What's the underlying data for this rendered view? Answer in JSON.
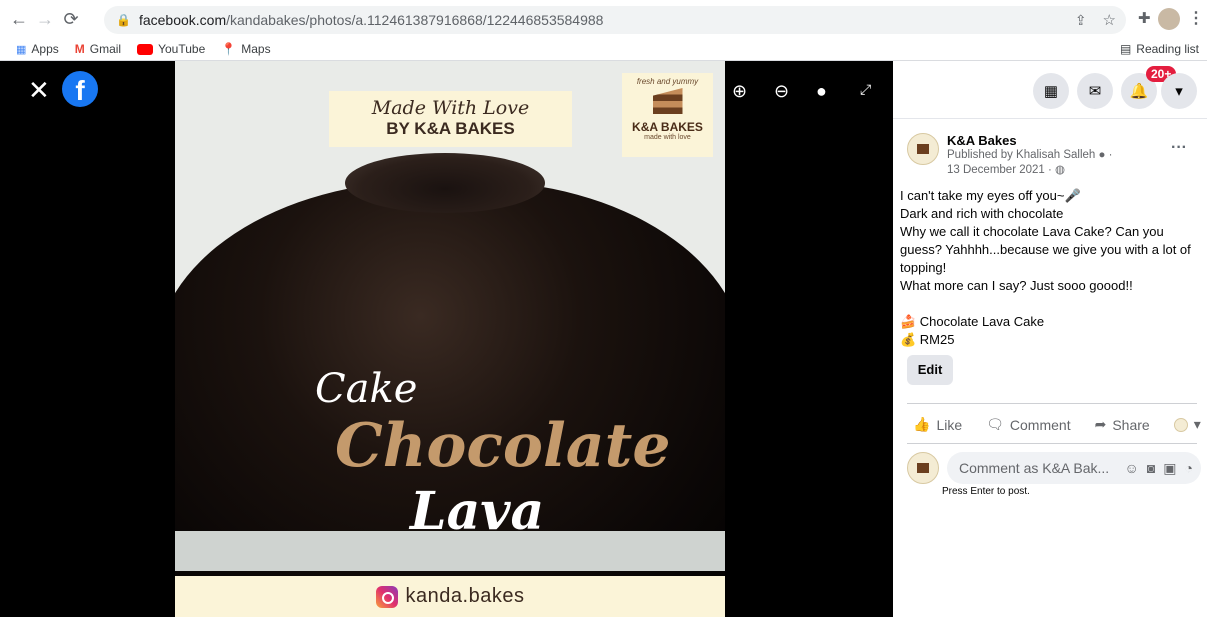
{
  "browser": {
    "url_host": "facebook.com",
    "url_path": "/kandabakes/photos/a.112461387916868/122446853584988",
    "bookmarks": [
      {
        "label": "Apps",
        "icon": "apps-grid-icon"
      },
      {
        "label": "Gmail",
        "icon": "gmail-icon"
      },
      {
        "label": "YouTube",
        "icon": "youtube-icon"
      },
      {
        "label": "Maps",
        "icon": "maps-icon"
      }
    ],
    "reading_list": "Reading list"
  },
  "photo": {
    "made_with_love": "Made With Love",
    "by": "BY K&A BAKES",
    "logo_top": "fresh and yummy",
    "logo_name": "K&A BAKES",
    "logo_sub": "made with love",
    "cake_word": "Cake",
    "chocolate_word": "Chocolate",
    "lava_word": "Lava",
    "instagram": "kanda.bakes"
  },
  "panel": {
    "notif_count": "20+",
    "page_name": "K&A Bakes",
    "published_by": "Published by Khalisah Salleh",
    "date": "13 December 2021",
    "text_lines": [
      "I can't take my eyes off you~🎤",
      "Dark and rich with chocolate",
      "Why we call it chocolate Lava Cake? Can you",
      "guess? Yahhhh...because we give you with a lot of",
      "topping!",
      "What more can I say? Just sooo goood!!",
      "",
      "🍰 Chocolate Lava Cake",
      "💰 RM25"
    ],
    "edit": "Edit",
    "like": "Like",
    "comment": "Comment",
    "share": "Share",
    "comment_placeholder": "Comment as K&A Bak...",
    "press_enter": "Press Enter to post."
  }
}
